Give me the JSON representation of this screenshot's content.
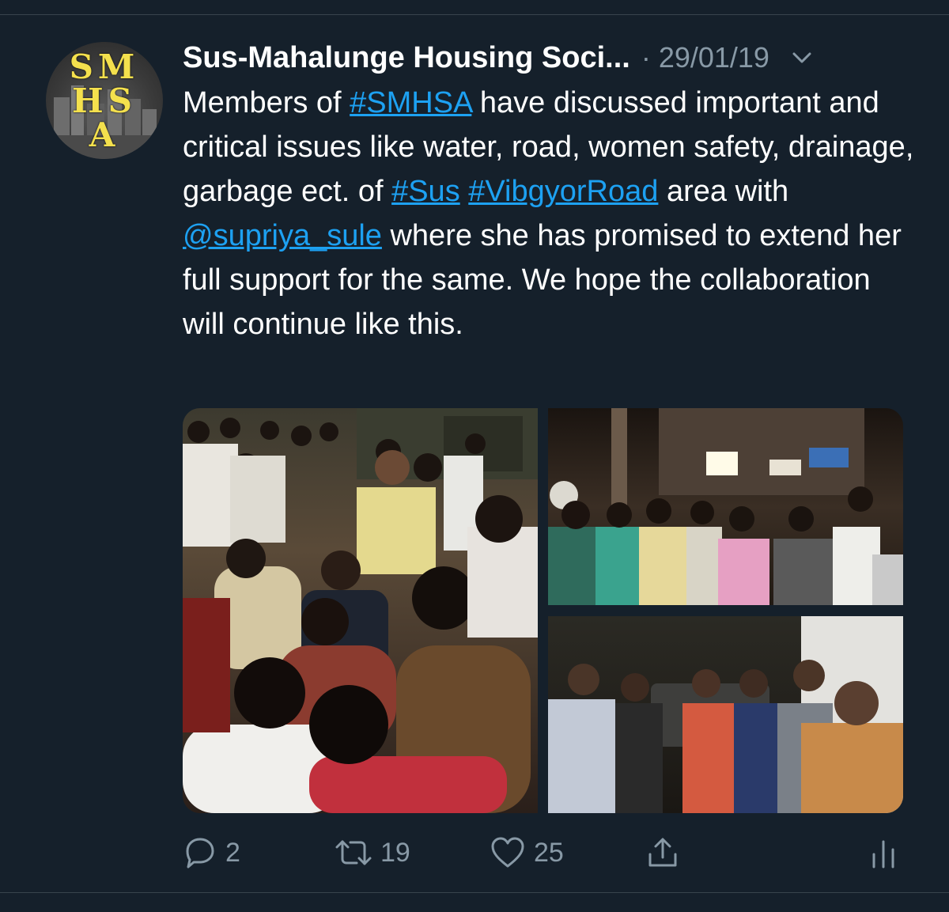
{
  "tweet": {
    "author_name": "Sus-Mahalunge Housing Soci...",
    "timestamp": "· 29/01/19",
    "avatar": {
      "letters_row1": "SM",
      "letters_row2": "HS",
      "letters_row3": "A"
    },
    "text": {
      "part1": "Members of ",
      "hashtag_smhsa": "#SMHSA",
      "part2": " have discussed important and critical issues like water, road, women safety, drainage, garbage ect. of ",
      "hashtag_sus": "#Sus",
      "part3": " ",
      "hashtag_vibgyor": "#VibgyorRoad",
      "part4": " area with ",
      "mention_supriya": "@supriya_sule",
      "part5": " where she has promised to extend her full support for the same. We hope the collaboration will continue like this."
    },
    "actions": {
      "reply_count": "2",
      "retweet_count": "19",
      "like_count": "25"
    }
  },
  "colors": {
    "background": "#15202b",
    "text": "#ffffff",
    "secondary": "#8899a6",
    "link": "#1da1f2",
    "divider": "#38444d",
    "avatar_letters": "#f4e04d"
  },
  "icons": [
    "chevron-down-icon",
    "reply-icon",
    "retweet-icon",
    "like-icon",
    "share-icon",
    "analytics-icon"
  ]
}
